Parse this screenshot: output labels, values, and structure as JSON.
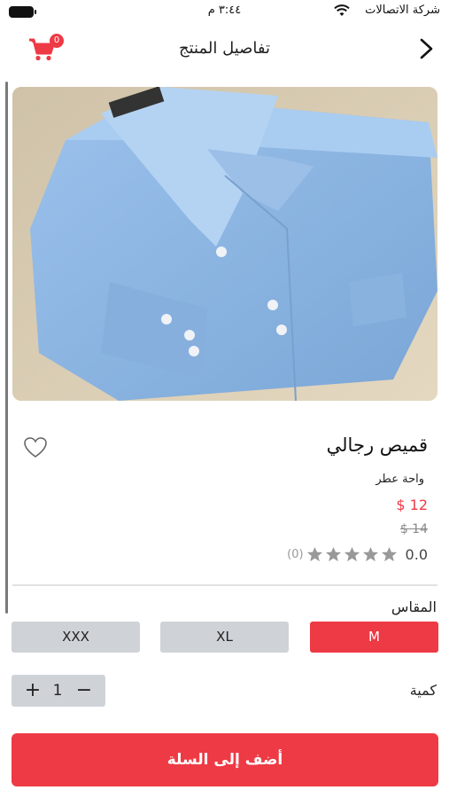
{
  "status_bar": {
    "carrier": "شركة الاتصالات",
    "time": "٣:٤٤ م",
    "icons": [
      "wifi-icon",
      "battery-icon"
    ]
  },
  "nav": {
    "title": "تفاصيل المنتج",
    "cart_count": "0",
    "icons": [
      "back-arrow-icon",
      "cart-icon"
    ]
  },
  "product": {
    "name": "قميص رجالي",
    "store": "واحة عطر",
    "price": "$ 12",
    "old_price": "$ 14",
    "rating": "0.0",
    "review_count": "(0)",
    "stars_filled": 0,
    "stars_total": 5,
    "image_count": 2,
    "active_image_index": 1
  },
  "size": {
    "label": "المقاس",
    "options": [
      "M",
      "XL",
      "XXX"
    ],
    "selected": "M"
  },
  "quantity": {
    "label": "كمية",
    "value": "1",
    "plus": "+",
    "minus": "−"
  },
  "add_to_cart_label": "أضف إلى السلة",
  "colors": {
    "accent": "#ee3a45",
    "option_bg": "#cfd3d8",
    "star": "#999999",
    "shirt": "#8db4e0"
  }
}
